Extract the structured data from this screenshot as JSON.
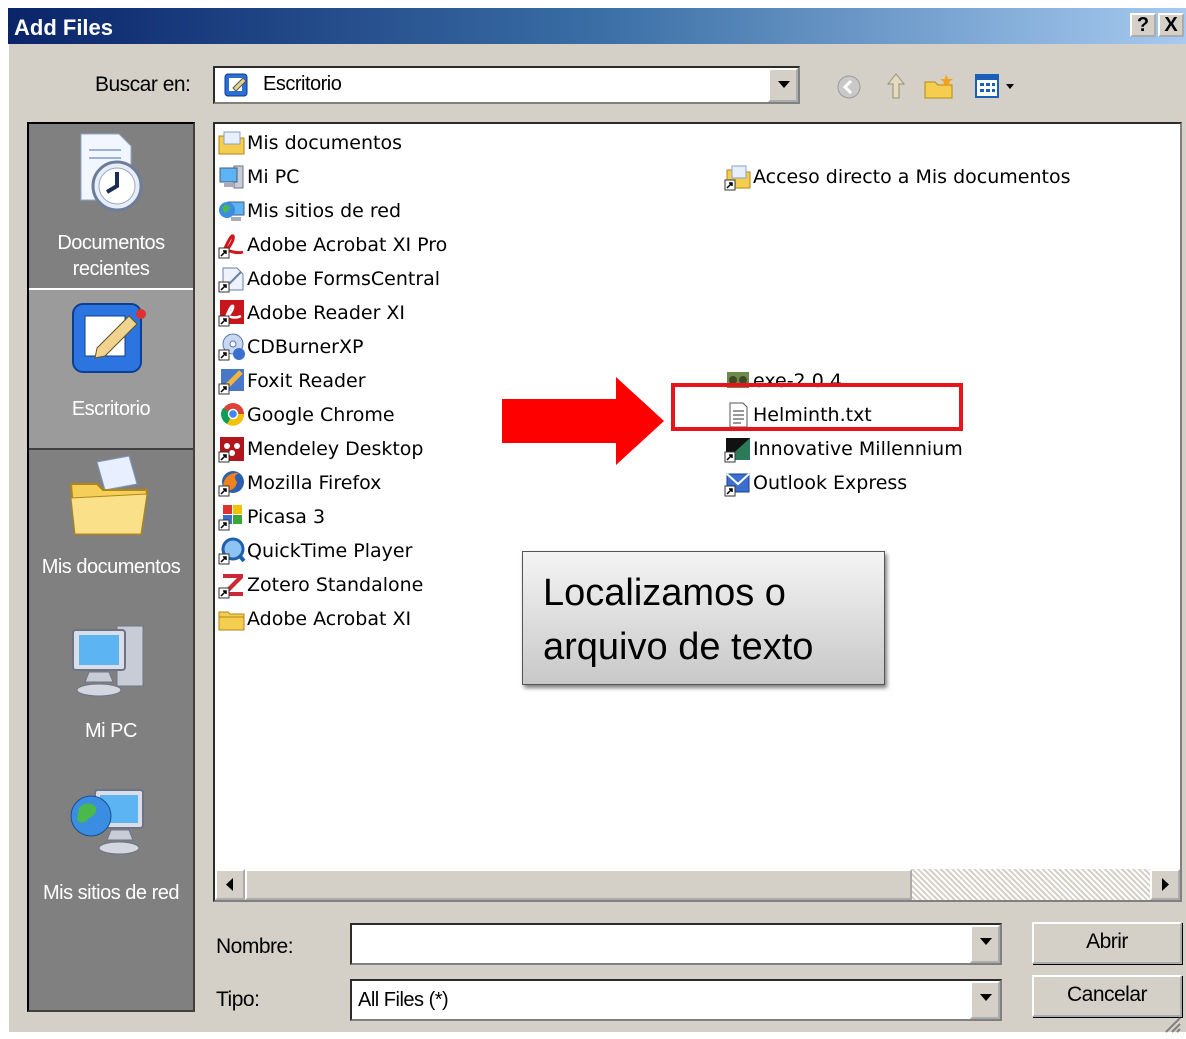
{
  "window": {
    "title": "Add Files",
    "help_label": "?",
    "close_label": "X"
  },
  "lookin": {
    "label": "Buscar en:",
    "value": "Escritorio"
  },
  "toolbar": {
    "icons": [
      "back-icon",
      "up-folder-icon",
      "new-folder-icon",
      "view-menu-icon"
    ]
  },
  "places": [
    {
      "label_line1": "Documentos",
      "label_line2": "recientes",
      "icon": "recent-documents-icon"
    },
    {
      "label_line1": "Escritorio",
      "label_line2": "",
      "icon": "desktop-icon",
      "selected": true
    },
    {
      "label_line1": "Mis documentos",
      "label_line2": "",
      "icon": "my-documents-icon"
    },
    {
      "label_line1": "Mi PC",
      "label_line2": "",
      "icon": "my-computer-icon"
    },
    {
      "label_line1": "Mis sitios de red",
      "label_line2": "",
      "icon": "network-places-icon"
    }
  ],
  "files_col1": [
    {
      "name": "Mis documentos",
      "icon": "folder-icon"
    },
    {
      "name": "Mi PC",
      "icon": "computer-icon"
    },
    {
      "name": "Mis sitios de red",
      "icon": "network-icon"
    },
    {
      "name": "Adobe Acrobat XI Pro",
      "icon": "acrobat-icon"
    },
    {
      "name": "Adobe FormsCentral",
      "icon": "formscentral-icon"
    },
    {
      "name": "Adobe Reader XI",
      "icon": "reader-icon"
    },
    {
      "name": "CDBurnerXP",
      "icon": "cdburner-icon"
    },
    {
      "name": "Foxit Reader",
      "icon": "foxit-icon"
    },
    {
      "name": "Google Chrome",
      "icon": "chrome-icon"
    },
    {
      "name": "Mendeley Desktop",
      "icon": "mendeley-icon"
    },
    {
      "name": "Mozilla Firefox",
      "icon": "firefox-icon"
    },
    {
      "name": "Picasa 3",
      "icon": "picasa-icon"
    },
    {
      "name": "QuickTime Player",
      "icon": "quicktime-icon"
    },
    {
      "name": "Zotero Standalone",
      "icon": "zotero-icon"
    },
    {
      "name": "Adobe Acrobat XI",
      "icon": "folder-icon"
    }
  ],
  "files_col2": [
    {
      "name": "Acceso directo a Mis documentos",
      "icon": "shortcut-icon"
    },
    {
      "name": "exe-2.0.4",
      "icon": "exe-icon"
    },
    {
      "name": "Helminth.txt",
      "icon": "text-file-icon"
    },
    {
      "name": "Innovative Millennium",
      "icon": "millennium-icon"
    },
    {
      "name": "Outlook Express",
      "icon": "outlook-icon"
    }
  ],
  "filename": {
    "label": "Nombre:",
    "value": ""
  },
  "filetype": {
    "label": "Tipo:",
    "value": "All Files (*)"
  },
  "buttons": {
    "open": "Abrir",
    "cancel": "Cancelar"
  },
  "annotation": {
    "callout_line1": "Localizamos o",
    "callout_line2": "arquivo de texto",
    "arrow_color": "#ff0000",
    "highlight_color": "#e8141b"
  }
}
